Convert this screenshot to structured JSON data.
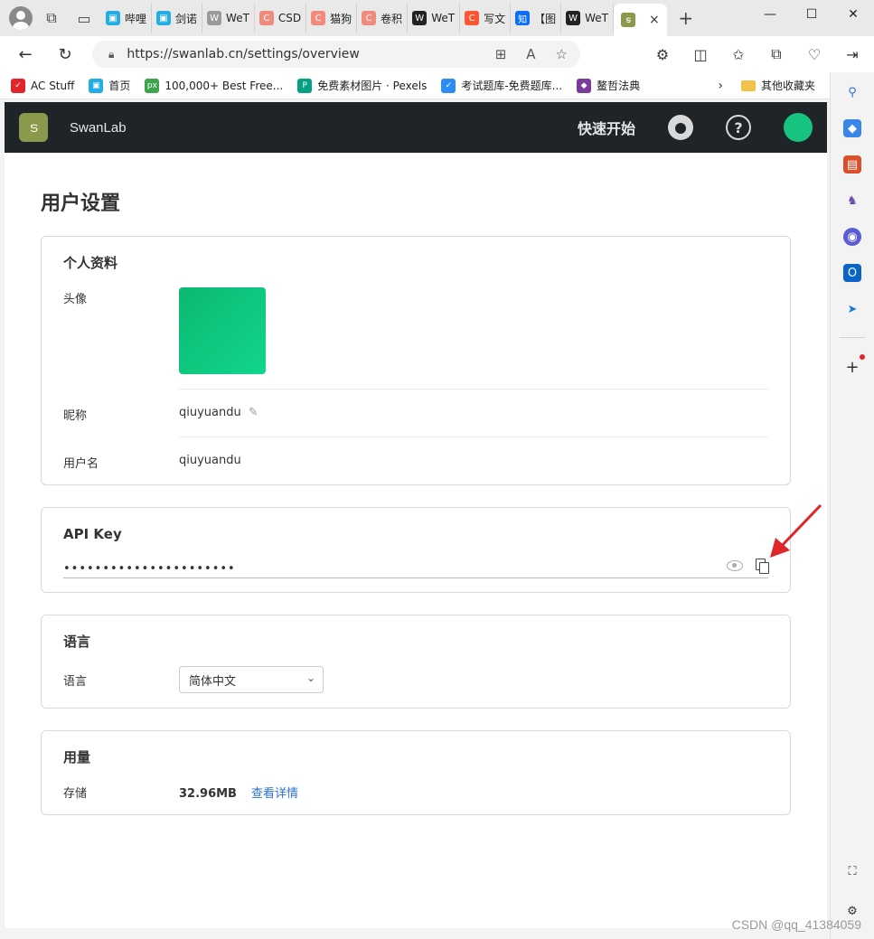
{
  "browser": {
    "tabs": [
      {
        "label": "哔哩",
        "color": "#23ade5",
        "glyph": "▣"
      },
      {
        "label": "剑诺",
        "color": "#23ade5",
        "glyph": "▣"
      },
      {
        "label": "WeT",
        "color": "#9a9a9a",
        "glyph": "W"
      },
      {
        "label": "CSD",
        "color": "#f08a7a",
        "glyph": "C"
      },
      {
        "label": "猫狗",
        "color": "#f08a7a",
        "glyph": "C"
      },
      {
        "label": "卷积",
        "color": "#f08a7a",
        "glyph": "C"
      },
      {
        "label": "WeT",
        "color": "#222222",
        "glyph": "W"
      },
      {
        "label": "写文",
        "color": "#fc5531",
        "glyph": "C"
      },
      {
        "label": "【图",
        "color": "#0b6ef4",
        "glyph": "知"
      },
      {
        "label": "WeT",
        "color": "#222222",
        "glyph": "W"
      }
    ],
    "active_tab": {
      "label": "",
      "close": "×"
    },
    "new_tab": "+",
    "url": "https://swanlab.cn/settings/overview",
    "bookmarks": [
      {
        "label": "AC Stuff",
        "color": "#e0262a",
        "glyph": "✓"
      },
      {
        "label": "首页",
        "color": "#23ade5",
        "glyph": "▣"
      },
      {
        "label": "100,000+ Best Free...",
        "color": "#3fa34d",
        "glyph": "px"
      },
      {
        "label": "免费素材图片 · Pexels",
        "color": "#05a081",
        "glyph": "P"
      },
      {
        "label": "考试题库-免费题库...",
        "color": "#2d8cf0",
        "glyph": "✓"
      },
      {
        "label": "鳌哲法典",
        "color": "#7a3b9c",
        "glyph": "◆"
      }
    ],
    "other_bookmarks": "其他收藏夹"
  },
  "header": {
    "brand": "SwanLab",
    "logo_glyph": "ട",
    "quick_start": "快速开始",
    "help_glyph": "?"
  },
  "page": {
    "title": "用户设置",
    "profile": {
      "title": "个人资料",
      "avatar_label": "头像",
      "nickname_label": "昵称",
      "nickname": "qiuyuandu",
      "username_label": "用户名",
      "username": "qiuyuandu"
    },
    "api": {
      "title": "API Key",
      "masked_key": "••••••••••••••••••••••"
    },
    "language": {
      "title": "语言",
      "label": "语言",
      "selected": "简体中文"
    },
    "usage": {
      "title": "用量",
      "storage_label": "存储",
      "storage_value": "32.96MB",
      "detail_link": "查看详情"
    }
  },
  "watermark": "CSDN @qq_41384059",
  "colors": {
    "header_bg": "#1f2428",
    "avatar_green": "#0bb872",
    "link_blue": "#2a71d0",
    "annotation_red": "#e0262a"
  }
}
